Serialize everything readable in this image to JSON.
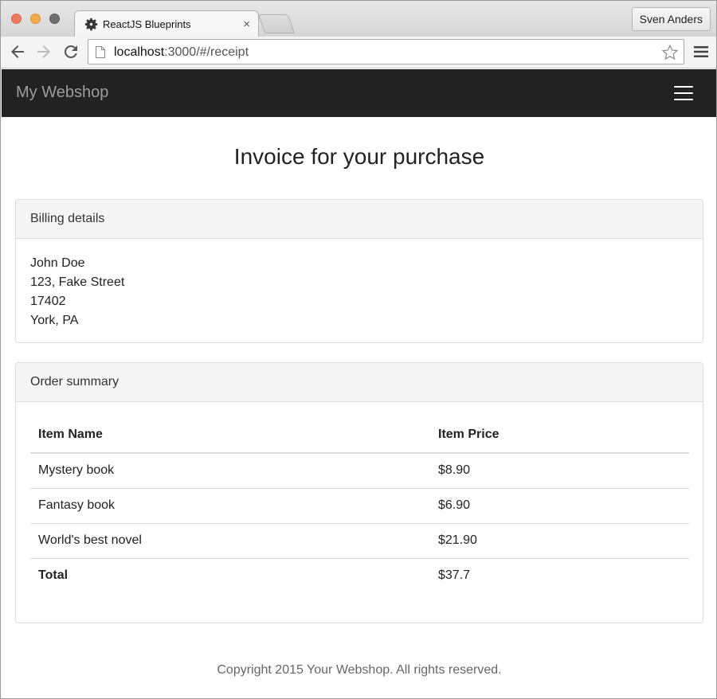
{
  "browser": {
    "tab_title": "ReactJS Blueprints",
    "tab_close": "×",
    "profile_name": "Sven Anders",
    "url_host": "localhost",
    "url_path": ":3000/#/receipt"
  },
  "navbar": {
    "brand": "My Webshop"
  },
  "page": {
    "title": "Invoice for your purchase"
  },
  "billing": {
    "heading": "Billing details",
    "lines": [
      "John Doe",
      "123, Fake Street",
      "17402",
      "York, PA"
    ]
  },
  "summary": {
    "heading": "Order summary",
    "columns": [
      "Item Name",
      "Item Price"
    ],
    "rows": [
      {
        "name": "Mystery book",
        "price": "$8.90"
      },
      {
        "name": "Fantasy book",
        "price": "$6.90"
      },
      {
        "name": "World's best novel",
        "price": "$21.90"
      }
    ],
    "total_label": "Total",
    "total_value": "$37.7"
  },
  "footer": {
    "text": "Copyright 2015 Your Webshop. All rights reserved."
  },
  "colors": {
    "navbar_bg": "#222222",
    "brand_text": "#9d9d9d",
    "panel_heading_bg": "#f5f5f5",
    "border": "#dddddd"
  },
  "icons": {
    "tab_favicon": "gear-icon",
    "back": "back-arrow-icon",
    "forward": "forward-arrow-icon",
    "reload": "reload-icon",
    "page": "page-icon",
    "bookmark": "star-icon",
    "browser_menu": "menu-icon",
    "nav_toggle": "hamburger-icon"
  }
}
